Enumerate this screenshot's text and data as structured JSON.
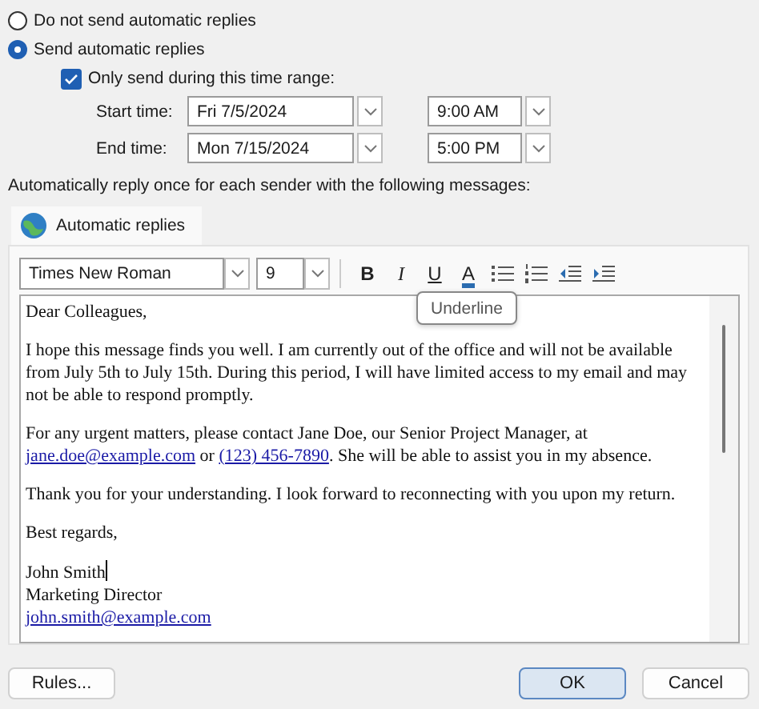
{
  "reply_mode": [
    {
      "label": "Do not send automatic replies",
      "selected": false
    },
    {
      "label": "Send automatic replies",
      "selected": true
    }
  ],
  "time_range": {
    "label": "Only send during this time range:",
    "checked": true
  },
  "times": [
    {
      "label": "Start time:",
      "date": "Fri 7/5/2024",
      "time": "9:00 AM"
    },
    {
      "label": "End time:",
      "date": "Mon 7/15/2024",
      "time": "5:00 PM"
    }
  ],
  "instruction": "Automatically reply once for each sender with the following messages:",
  "tabs": [
    {
      "label": "Automatic replies",
      "selected": true
    }
  ],
  "toolbar": {
    "font": "Times New Roman",
    "size": "9",
    "buttons": [
      {
        "kind": "bold",
        "label": "B"
      },
      {
        "kind": "italic",
        "label": "I"
      },
      {
        "kind": "underline",
        "label": "U"
      },
      {
        "kind": "font-color",
        "label": "A"
      },
      {
        "kind": "bullets"
      },
      {
        "kind": "numbering"
      },
      {
        "kind": "outdent"
      },
      {
        "kind": "indent"
      }
    ]
  },
  "tooltip": "Underline",
  "message": [
    {
      "parts": [
        {
          "text": "Dear Colleagues,"
        }
      ]
    },
    {
      "parts": [
        {
          "text": "I hope this message finds you well. I am currently out of the office and will not be available from July 5th to July 15th. During this period, I will have limited access to my email and may not be able to respond promptly."
        }
      ]
    },
    {
      "parts": [
        {
          "text": "For any urgent matters, please contact Jane Doe, our Senior Project Manager, at "
        },
        {
          "text": "jane.doe@example.com",
          "link": true
        },
        {
          "text": " or "
        },
        {
          "text": "(123) 456-7890",
          "link": true
        },
        {
          "text": ". She will be able to assist you in my absence."
        }
      ]
    },
    {
      "parts": [
        {
          "text": "Thank you for your understanding. I look forward to reconnecting with you upon my return."
        }
      ]
    },
    {
      "parts": [
        {
          "text": "Best regards,"
        }
      ]
    }
  ],
  "signature": [
    {
      "text": "John Smith",
      "kind": "text",
      "cursor": true
    },
    {
      "text": "Marketing Director",
      "kind": "text"
    },
    {
      "text": "john.smith@example.com",
      "kind": "link"
    }
  ],
  "buttons": [
    {
      "label": "Rules...",
      "default": false
    },
    {
      "label": "OK",
      "default": true
    },
    {
      "label": "Cancel",
      "default": false
    }
  ]
}
